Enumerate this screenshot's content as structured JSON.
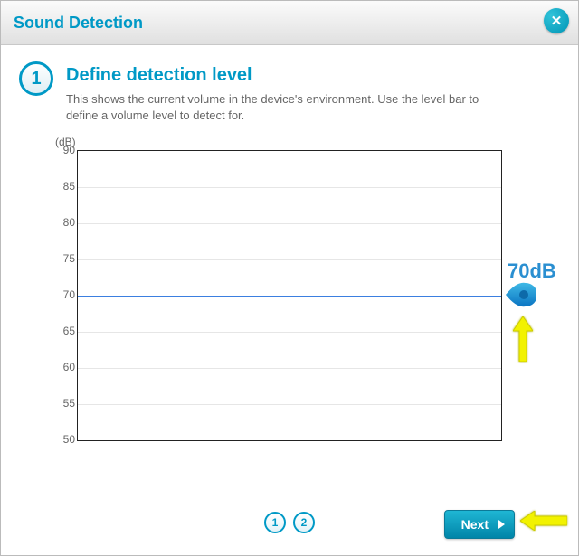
{
  "header": {
    "title": "Sound Detection"
  },
  "step": {
    "number": "1",
    "title": "Define detection level",
    "description": "This shows the current volume in the device's environment. Use the level bar to define a volume level to detect for."
  },
  "chart_data": {
    "type": "line",
    "ylabel": "(dB)",
    "ylim": [
      50,
      90
    ],
    "ticks": [
      90,
      85,
      80,
      75,
      70,
      65,
      60,
      55,
      50
    ],
    "threshold": 70,
    "threshold_label": "70dB"
  },
  "pager": {
    "pages": [
      "1",
      "2"
    ],
    "current": 1
  },
  "buttons": {
    "next": "Next"
  }
}
